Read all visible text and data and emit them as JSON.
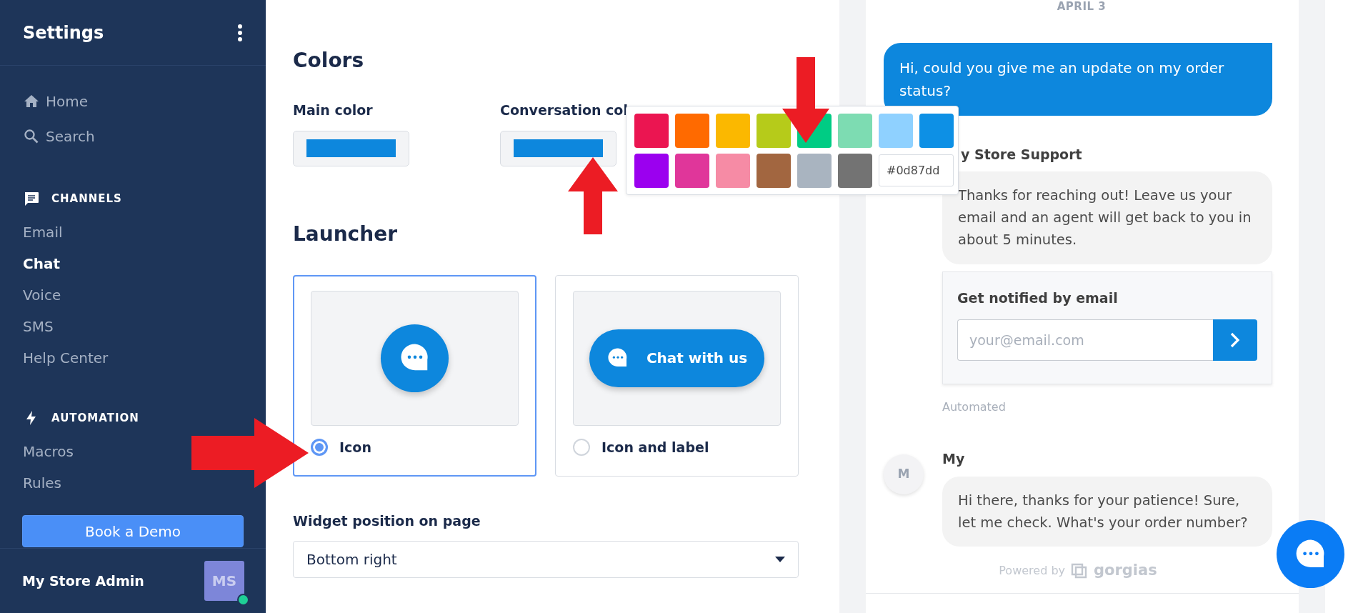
{
  "sidebar": {
    "title": "Settings",
    "top_items": [
      {
        "label": "Home"
      },
      {
        "label": "Search"
      }
    ],
    "sections": [
      {
        "title": "CHANNELS",
        "items": [
          {
            "label": "Email",
            "selected": false
          },
          {
            "label": "Chat",
            "selected": true
          },
          {
            "label": "Voice",
            "selected": false
          },
          {
            "label": "SMS",
            "selected": false
          },
          {
            "label": "Help Center",
            "selected": false
          }
        ]
      },
      {
        "title": "AUTOMATION",
        "items": [
          {
            "label": "Macros",
            "selected": false
          },
          {
            "label": "Rules",
            "selected": false
          }
        ]
      }
    ],
    "cta": "Book a Demo",
    "user": {
      "name": "My Store Admin",
      "initials": "MS",
      "online": true
    }
  },
  "colors": {
    "title": "Colors",
    "fields": [
      {
        "label": "Main color",
        "color": "#0d87dd"
      },
      {
        "label": "Conversation col",
        "color": "#0d87dd"
      }
    ]
  },
  "color_picker": {
    "swatches": [
      {
        "color": "#eb1551"
      },
      {
        "color": "#ff6a00"
      },
      {
        "color": "#fbb800"
      },
      {
        "color": "#b6cb1a"
      },
      {
        "color": "#00cc84"
      },
      {
        "color": "#7ddcb2"
      },
      {
        "color": "#8fd1ff"
      },
      {
        "color": "#0d90e5"
      },
      {
        "color": "#9b00ef"
      },
      {
        "color": "#e0369a"
      },
      {
        "color": "#f68ba5"
      },
      {
        "color": "#a26640"
      },
      {
        "color": "#a9b4c0"
      },
      {
        "color": "#737373"
      }
    ],
    "hex_value": "#0d87dd"
  },
  "launcher": {
    "title": "Launcher",
    "options": [
      {
        "kind": "icon",
        "label": "Icon",
        "selected": true
      },
      {
        "kind": "icon_label",
        "label": "Icon and label",
        "selected": false,
        "button_text": "Chat with us"
      }
    ]
  },
  "widget_position": {
    "label": "Widget position on page",
    "value": "Bottom right"
  },
  "chat_preview": {
    "date": "APRIL 3",
    "messages": [
      {
        "kind": "customer",
        "text": "Hi, could you give me an update on my order status?"
      },
      {
        "kind": "agent",
        "sender": "y Store Support",
        "text": "Thanks for reaching out! Leave us your email and an agent will get back to you in about 5 minutes."
      },
      {
        "kind": "email_capture",
        "title": "Get notified by email",
        "placeholder": "your@email.com",
        "note": "Automated"
      },
      {
        "kind": "agent",
        "avatar": "M",
        "sender": "My",
        "text": "Hi there, thanks for your patience! Sure, let me check. What's your order number?"
      }
    ],
    "powered_by": "Powered by",
    "brand": "gorgias"
  }
}
